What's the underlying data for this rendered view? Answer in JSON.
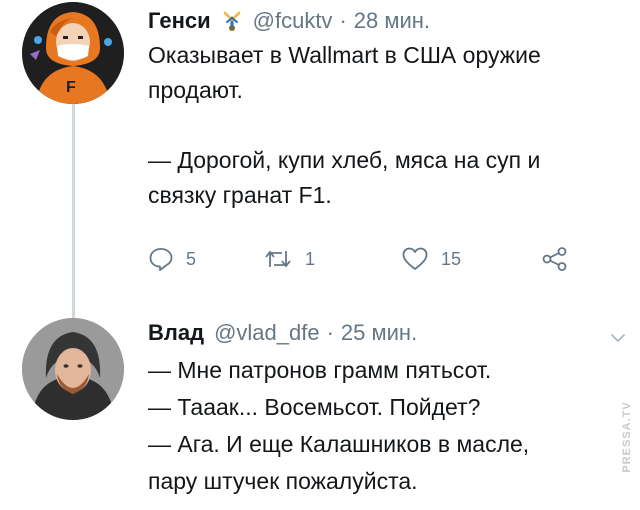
{
  "tweets": [
    {
      "name": "Генси",
      "handle": "@fcuktv",
      "separator": "·",
      "time": "28 мин.",
      "text_lines": [
        "Оказывает в Wallmart в США оружие",
        "продают.",
        "",
        "— Дорогой, купи хлеб, мяса на суп и",
        "связку гранат F1."
      ],
      "replies": "5",
      "retweets": "1",
      "likes": "15"
    },
    {
      "name": "Влад",
      "handle": "@vlad_dfe",
      "separator": "·",
      "time": "25 мин.",
      "text_lines": [
        "— Мне патронов грамм пятьсот.",
        "— Тааак... Восемьсот. Пойдет?",
        "— Ага. И еще Калашников в масле,",
        "пару штучек пожалуйста."
      ]
    }
  ],
  "watermark": {
    "text": "PRESSA.TV"
  },
  "icons": {
    "badge": "cartwheel-emoji-icon",
    "reply": "reply-icon",
    "retweet": "retweet-icon",
    "like": "heart-icon",
    "share": "share-icon",
    "menu": "chevron-down-icon"
  },
  "colors": {
    "text": "#14171a",
    "secondary": "#657786",
    "thread_line": "#cfd9de"
  }
}
